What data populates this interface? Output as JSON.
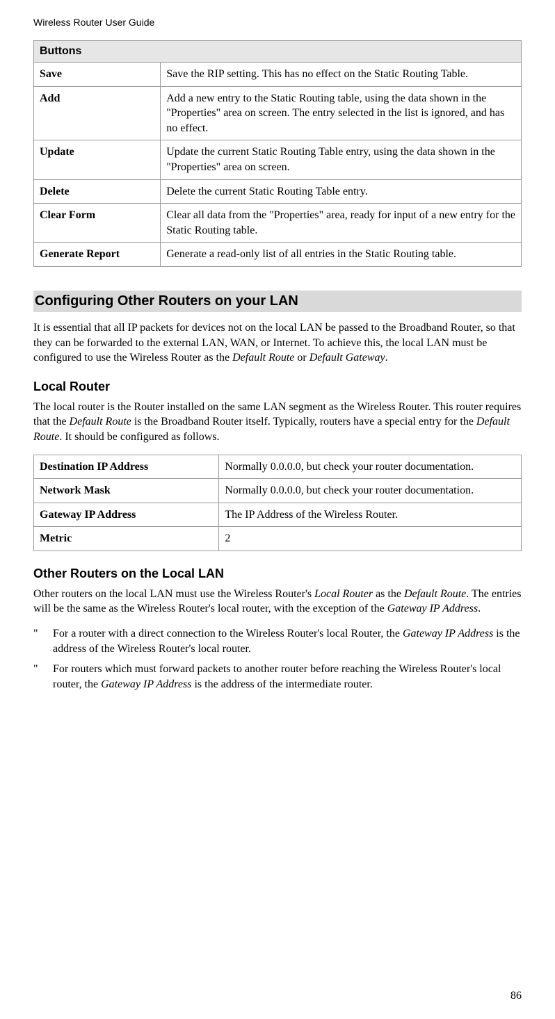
{
  "header": "Wireless Router User Guide",
  "buttons_table": {
    "title": "Buttons",
    "rows": [
      {
        "k": "Save",
        "v": "Save the RIP setting. This has no effect on the Static Routing Table."
      },
      {
        "k": "Add",
        "v": "Add a new entry to the Static Routing table, using the data shown in the \"Properties\" area on screen. The entry selected in the list is ignored, and has no effect."
      },
      {
        "k": "Update",
        "v": "Update the current Static Routing Table entry, using the data shown in the \"Properties\" area on screen."
      },
      {
        "k": "Delete",
        "v": "Delete the current Static Routing Table entry."
      },
      {
        "k": "Clear Form",
        "v": "Clear all data from the \"Properties\" area, ready for input of a new entry for the Static Routing table."
      },
      {
        "k": "Generate Report",
        "v": "Generate a read-only list of all entries in the Static Routing table."
      }
    ]
  },
  "section1": {
    "title": "Configuring Other Routers on your LAN",
    "para_parts": [
      "It is essential that all IP packets for devices not on the local LAN be passed to the Broadband Router, so that they can be forwarded to the external LAN, WAN, or Internet. To achieve this, the local LAN must be configured to use the Wireless Router as the ",
      "Default Route",
      " or ",
      "Default Gateway",
      "."
    ]
  },
  "local_router": {
    "title": "Local Router",
    "para_parts": [
      "The local router is the Router installed on the same LAN segment as the Wireless Router. This router requires that the ",
      "Default Route",
      " is the Broadband Router itself. Typically, routers have a special entry for the ",
      "Default Route",
      ". It should be configured as follows."
    ],
    "rows": [
      {
        "k": "Destination IP Address",
        "v": "Normally 0.0.0.0, but check your router documentation."
      },
      {
        "k": "Network Mask",
        "v": "Normally 0.0.0.0, but check your router documentation."
      },
      {
        "k": "Gateway IP Address",
        "v": "The IP Address of the Wireless Router."
      },
      {
        "k": "Metric",
        "v": "2"
      }
    ]
  },
  "other_routers": {
    "title": "Other Routers on the Local LAN",
    "para_parts": [
      "Other routers on the local LAN must use the Wireless Router's ",
      "Local Router",
      " as the ",
      "Default Route",
      ". The entries will be the same as the Wireless Router's local router, with the exception of the ",
      "Gateway IP Address",
      "."
    ],
    "bullets": [
      [
        "For a router with a direct connection to the Wireless Router's local Router, the ",
        "Gateway IP Address",
        " is the address of the Wireless Router's local router."
      ],
      [
        "For routers which must forward packets to another router before reaching the Wireless Router's local router, the ",
        "Gateway IP Address",
        " is the address of the intermediate router."
      ]
    ],
    "bullet_mark": "\""
  },
  "page_number": "86"
}
